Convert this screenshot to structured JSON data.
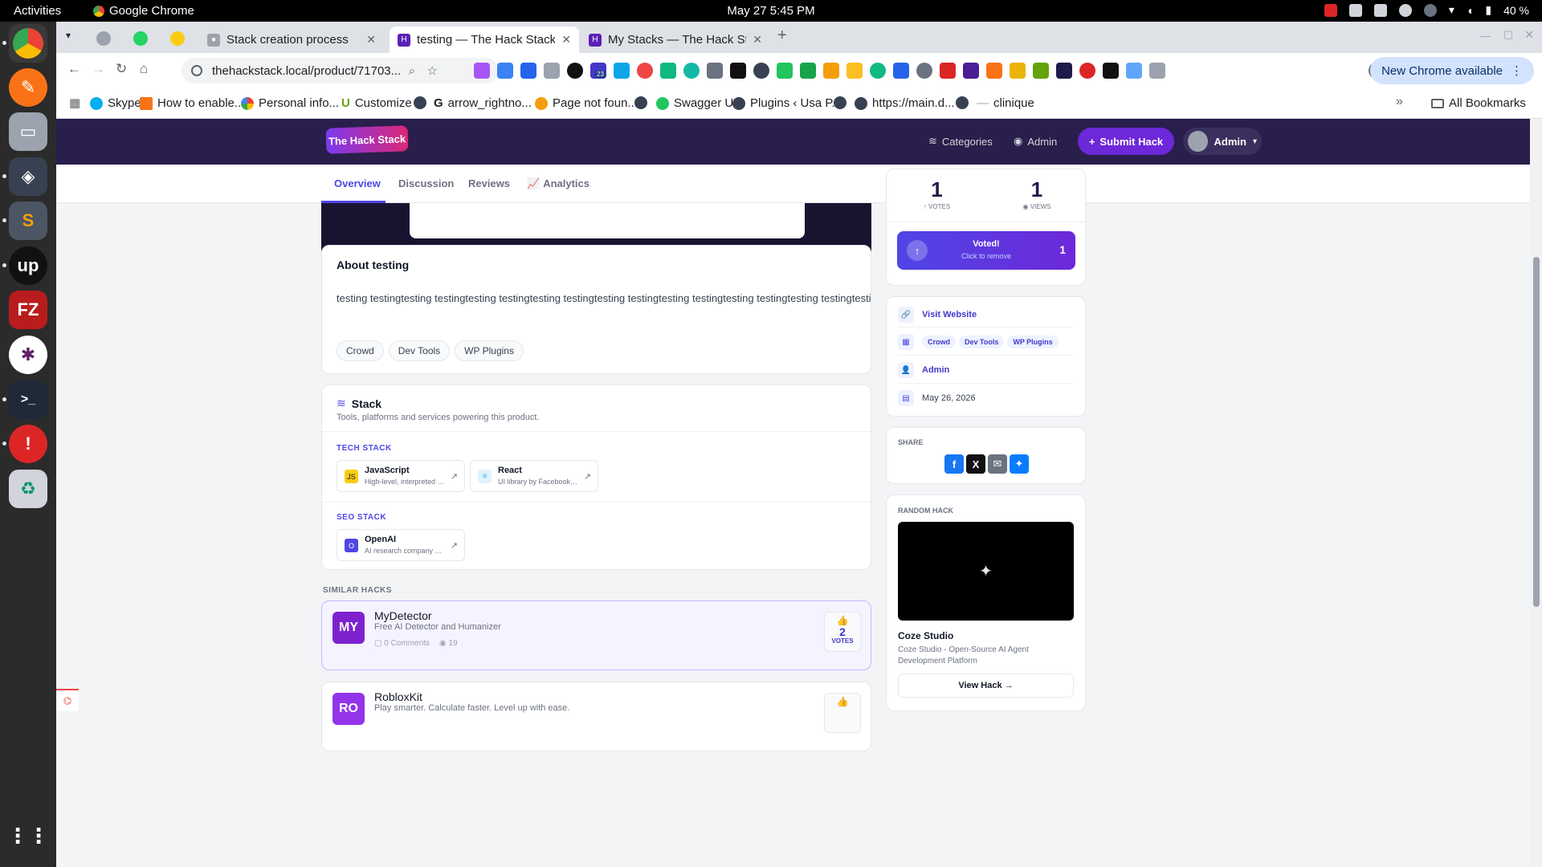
{
  "topbar": {
    "activities": "Activities",
    "app_name": "Google Chrome",
    "clock": "May 27  5:45 PM",
    "battery": "40 %"
  },
  "tabs": [
    {
      "title": "Stack creation process"
    },
    {
      "title": "testing — The Hack Stack"
    },
    {
      "title": "My Stacks — The Hack Stack"
    }
  ],
  "toolbar": {
    "url": "thehackstack.local/product/71703...",
    "new_chrome": "New Chrome available",
    "ext_badge": "23"
  },
  "bookmarks": [
    {
      "label": "Skype"
    },
    {
      "label": "How to enable..."
    },
    {
      "label": "Personal info..."
    },
    {
      "label": "Customize"
    },
    {
      "label": ""
    },
    {
      "label": "arrow_rightno..."
    },
    {
      "label": "Page not foun..."
    },
    {
      "label": ""
    },
    {
      "label": "Swagger UI"
    },
    {
      "label": "Plugins ‹ Usa P..."
    },
    {
      "label": ""
    },
    {
      "label": "https://main.d..."
    },
    {
      "label": ""
    },
    {
      "label": "clinique"
    }
  ],
  "all_bookmarks": "All Bookmarks",
  "site": {
    "logo_text": "The Hack Stack",
    "nav_categories": "Categories",
    "nav_admin": "Admin",
    "submit_label": "Submit Hack",
    "user_label": "Admin"
  },
  "subnav": [
    "Overview",
    "Discussion",
    "Reviews",
    "Analytics"
  ],
  "about": {
    "title": "About testing",
    "text": "testing testingtesting testingtesting testingtesting testingtesting testingtesting testingtesting testingtesting testingtesting testingtesting testing",
    "tags": [
      "Crowd",
      "Dev Tools",
      "WP Plugins"
    ]
  },
  "stack": {
    "title": "Stack",
    "subtitle": "Tools, platforms and services powering this product.",
    "tech_label": "TECH STACK",
    "seo_label": "SEO STACK",
    "tech": [
      {
        "name": "JavaScript",
        "desc": "High-level, interpreted s...",
        "icon": "JS"
      },
      {
        "name": "React",
        "desc": "UI library by Facebook f...",
        "icon": "⚛"
      }
    ],
    "seo": [
      {
        "name": "OpenAI",
        "desc": "AI research company an...",
        "icon": "O"
      }
    ]
  },
  "similar": {
    "label": "SIMILAR HACKS",
    "items": [
      {
        "initials": "MY",
        "name": "MyDetector",
        "desc": "Free AI Detector and Humanizer",
        "comments": "0 Comments",
        "views": "19",
        "votes": "2",
        "votes_label": "VOTES"
      },
      {
        "initials": "RO",
        "name": "RobloxKit",
        "desc": "Play smarter. Calculate faster. Level up with ease."
      }
    ]
  },
  "stats": {
    "votes": "1",
    "votes_label": "VOTES",
    "views": "1",
    "views_label": "VIEWS"
  },
  "voted": {
    "title": "Voted!",
    "subtitle": "Click to remove",
    "count": "1"
  },
  "info": {
    "website": "Visit Website",
    "tags": [
      "Crowd",
      "Dev Tools",
      "WP Plugins"
    ],
    "author": "Admin",
    "date": "May 26, 2026"
  },
  "share": {
    "label": "SHARE",
    "icons": [
      "facebook-icon",
      "x-icon",
      "email-icon",
      "messenger-icon"
    ]
  },
  "random": {
    "label": "RANDOM HACK",
    "name": "Coze Studio",
    "desc": "Coze Studio - Open-Source AI Agent Development Platform",
    "button": "View Hack →"
  },
  "colors": {
    "accent": "#4f46e5",
    "header_bg": "#2a1e4c",
    "voted_bg": "#5b3fd6"
  }
}
